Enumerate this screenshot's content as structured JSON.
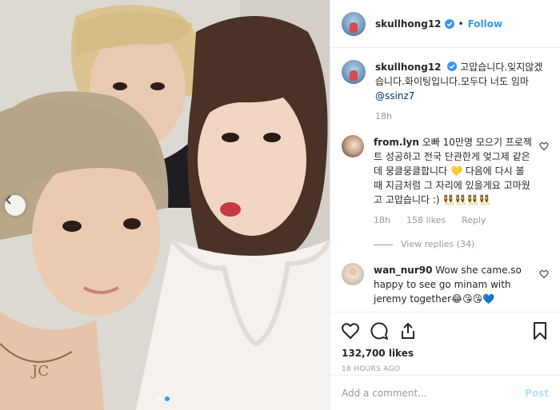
{
  "post": {
    "username": "skullhong12",
    "follow_label": "Follow",
    "separator": "•",
    "likes": "132,700 likes",
    "timestamp": "18 HOURS AGO"
  },
  "caption": {
    "username": "skullhong12",
    "text": "고맙습니다.잊지않겠습니다.화이팅입니다.모두다 너도 임마 ",
    "mention": "@ssinz7",
    "time": "18h"
  },
  "comments": [
    {
      "username": "from.lyn",
      "text": "오빠 10만명 모으기 프로젝트 성공하고 전국 단관한게 엊그제 같은데 뭉클뭉클합니다 💛 다음에 다시 볼 때 지금처럼 그 자리에 있을게요 고마웠고 고맙습니다 :) 👯‍♀️👯‍♀️👯‍♀️👯‍♀️",
      "time": "18h",
      "likes": "158 likes",
      "reply": "Reply",
      "view_replies": "View replies (34)"
    },
    {
      "username": "wan_nur90",
      "text": "Wow she came.so happy to see go minam with jeremy together😂😘😘💙"
    }
  ],
  "add_comment": {
    "placeholder": "Add a comment...",
    "post_label": "Post"
  },
  "icons": [
    "chevron-left-icon",
    "verified-badge-icon",
    "heart-icon",
    "comment-icon",
    "share-icon",
    "bookmark-icon"
  ],
  "colors": {
    "accent": "#3897f0",
    "verified": "#3897f0",
    "post_disabled": "#b2dffc",
    "muted": "#999999"
  }
}
